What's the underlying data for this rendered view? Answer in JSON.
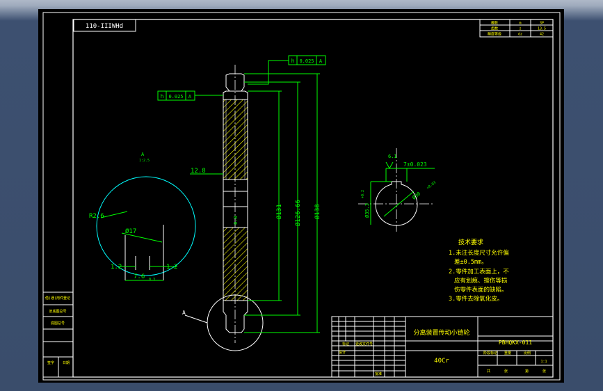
{
  "drawing_number_box": "110-IIIWHd",
  "title_block_top_right": {
    "rows": [
      [
        "模数",
        "m",
        "3P"
      ],
      [
        "齿数",
        "z",
        "13.5"
      ],
      [
        "精度等级",
        "dz",
        "42"
      ]
    ]
  },
  "tolerance_frames": {
    "upper": {
      "symbol": "h",
      "value": "0.025",
      "datum": "A"
    },
    "left": {
      "symbol": "h",
      "value": "0.025",
      "datum": "A"
    }
  },
  "dimensions": {
    "d1": "12.8",
    "d2": "Ø131",
    "d3": "Ø126.66",
    "d4": "Ø138",
    "d5": "0.8",
    "keyway_width": "7±0.023",
    "keyway_depth": "Ø35.3",
    "keyway_depth_tol": "+0.2",
    "bore": "Ø30",
    "bore_tol": "+0.03",
    "roughness_keyway": "6.1",
    "detail_r": "R2.6",
    "detail_angle": "Ø17",
    "detail_left": "1.2",
    "detail_right": "1.2",
    "detail_bottom": "7.6",
    "detail_bottom_tol": "0.3"
  },
  "detail": {
    "label": "A",
    "scale": "1:2.5",
    "callout": "A"
  },
  "tech_requirements": {
    "title": "技术要求",
    "lines": [
      "1.未注长度尺寸允许偏",
      "差±0.5mm。",
      "2.零件加工表面上，不",
      "应有划痕、擦伤等损",
      "伤零件表面的缺陷。",
      "3.零件去除氧化皮。"
    ]
  },
  "title_block": {
    "part_name": "分离装置传动小链轮",
    "drawing_code": "PBHQKX-011",
    "material": "40Cr",
    "scale_label": "1:1",
    "row_labels": [
      "设计",
      "标准化",
      "审核",
      "工艺",
      "批准"
    ],
    "header_labels": [
      "标记",
      "处数",
      "分区",
      "更改文件号",
      "签名",
      "日期"
    ],
    "right_labels": [
      "阶段标记",
      "重量",
      "比例",
      "共",
      "张",
      "第",
      "张"
    ]
  },
  "left_strip": {
    "labels": [
      "借(通)用件登记",
      "旧底图总号",
      "底图总号",
      "签字",
      "日期"
    ]
  },
  "colors": {
    "drawing_bg": "#000000",
    "lines_white": "#ffffff",
    "dimension_green": "#00ff00",
    "detail_cyan": "#00ffff",
    "text_yellow": "#ffff00",
    "hatch_yellow": "#ffff00"
  }
}
